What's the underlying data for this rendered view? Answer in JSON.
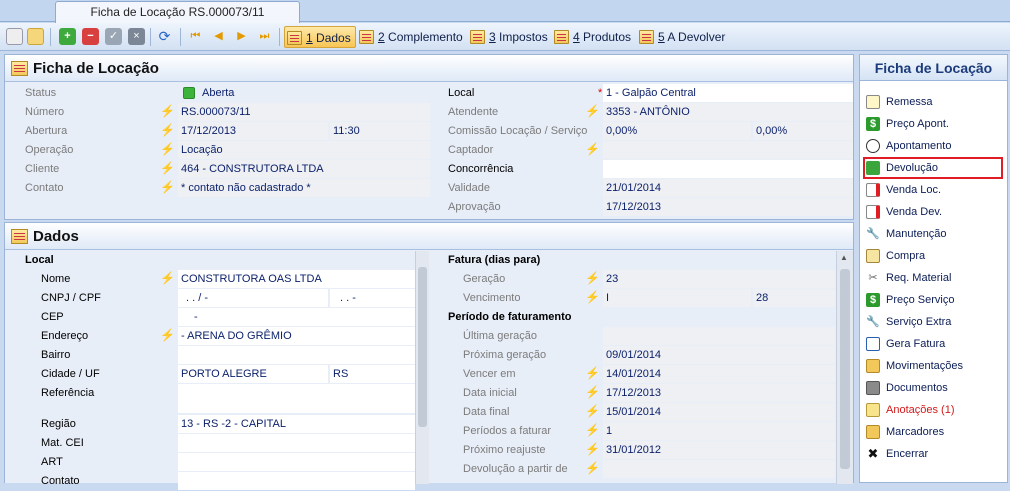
{
  "window": {
    "doc_tab": "Ficha de Locação RS.000073/11"
  },
  "toolbar": {
    "tabs": [
      {
        "label_num": "1",
        "label_text": " Dados"
      },
      {
        "label_num": "2",
        "label_text": " Complemento"
      },
      {
        "label_num": "3",
        "label_text": " Impostos"
      },
      {
        "label_num": "4",
        "label_text": " Produtos"
      },
      {
        "label_num": "5",
        "label_text": " A Devolver"
      }
    ]
  },
  "ficha": {
    "title": "Ficha de Locação",
    "status_label": "Status",
    "status_value": "Aberta",
    "numero_label": "Número",
    "numero_value": "RS.000073/11",
    "abertura_label": "Abertura",
    "abertura_date": "17/12/2013",
    "abertura_time": "11:30",
    "operacao_label": "Operação",
    "operacao_value": "Locação",
    "cliente_label": "Cliente",
    "cliente_value": "464 - CONSTRUTORA LTDA",
    "contato_label": "Contato",
    "contato_value": "* contato não cadastrado *",
    "local_label": "Local",
    "local_star": "*",
    "local_value": "1 - Galpão Central",
    "atendente_label": "Atendente",
    "atendente_value": "3353 - ANTÔNIO",
    "comissao_label": "Comissão Locação / Serviço",
    "comissao_v1": "0,00%",
    "comissao_v2": "0,00%",
    "captador_label": "Captador",
    "concorrencia_label": "Concorrência",
    "validade_label": "Validade",
    "validade_value": "21/01/2014",
    "aprovacao_label": "Aprovação",
    "aprovacao_value": "17/12/2013"
  },
  "dados": {
    "title": "Dados",
    "local_header": "Local",
    "nome_label": "Nome",
    "nome_value": "CONSTRUTORA OAS LTDA",
    "cnpj_label": "CNPJ / CPF",
    "cnpj_v1": ". . /  -",
    "cnpj_v2": ". . -",
    "cep_label": "CEP",
    "cep_value": "-",
    "endereco_label": "Endereço",
    "endereco_value": "- ARENA DO GRÊMIO",
    "bairro_label": "Bairro",
    "cidade_label": "Cidade / UF",
    "cidade_value": "PORTO ALEGRE",
    "uf_value": "RS",
    "referencia_label": "Referência",
    "regiao_label": "Região",
    "regiao_value": "13 - RS -2 - CAPITAL",
    "matcei_label": "Mat. CEI",
    "art_label": "ART",
    "contato_label": "Contato",
    "fatura_header": "Fatura (dias para)",
    "geracao_label": "Geração",
    "geracao_value": "23",
    "vencimento_label": "Vencimento",
    "vencimento_v1": "I",
    "vencimento_v2": "28",
    "periodo_header": "Período de faturamento",
    "ultima_label": "Última geração",
    "proxima_label": "Próxima geração",
    "proxima_value": "09/01/2014",
    "vencer_label": "Vencer em",
    "vencer_value": "14/01/2014",
    "datainicial_label": "Data inicial",
    "datainicial_value": "17/12/2013",
    "datafinal_label": "Data final",
    "datafinal_value": "15/01/2014",
    "periodos_label": "Períodos a faturar",
    "periodos_value": "1",
    "reajuste_label": "Próximo reajuste",
    "reajuste_value": "31/01/2012",
    "devolucao_label": "Devolução a partir de"
  },
  "sidepanel": {
    "title": "Ficha de Locação",
    "items": [
      "Remessa",
      "Preço Apont.",
      "Apontamento",
      "Devolução",
      "Venda Loc.",
      "Venda Dev.",
      "Manutenção",
      "Compra",
      "Req. Material",
      "Preço Serviço",
      "Serviço Extra",
      "Gera Fatura",
      "Movimentações",
      "Documentos",
      "Anotações (1)",
      "Marcadores",
      "Encerrar"
    ]
  },
  "colors": {
    "accent": "#1b3b7a",
    "highlight": "#e01c24",
    "status_green": "#3cb43c"
  }
}
